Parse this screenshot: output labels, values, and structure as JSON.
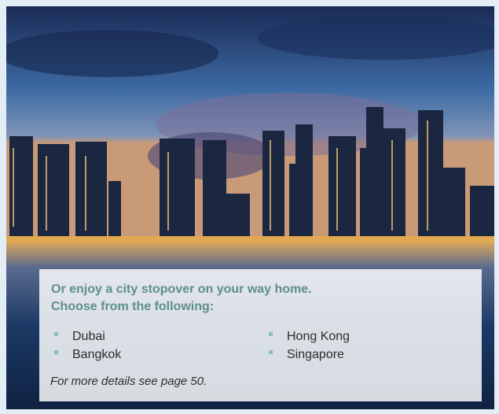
{
  "image": {
    "description_icon": "city-skyline-photo"
  },
  "callout": {
    "heading_line1": "Or enjoy a city stopover on your way home.",
    "heading_line2": "Choose from the following:",
    "cities_left": [
      "Dubai",
      "Bangkok"
    ],
    "cities_right": [
      "Hong Kong",
      "Singapore"
    ],
    "footnote": "For more details see page 50."
  },
  "colors": {
    "heading": "#5d8f8b",
    "bullet": "#8dbcb4",
    "body_text": "#2e2e2e",
    "frame": "#e3edf5"
  }
}
